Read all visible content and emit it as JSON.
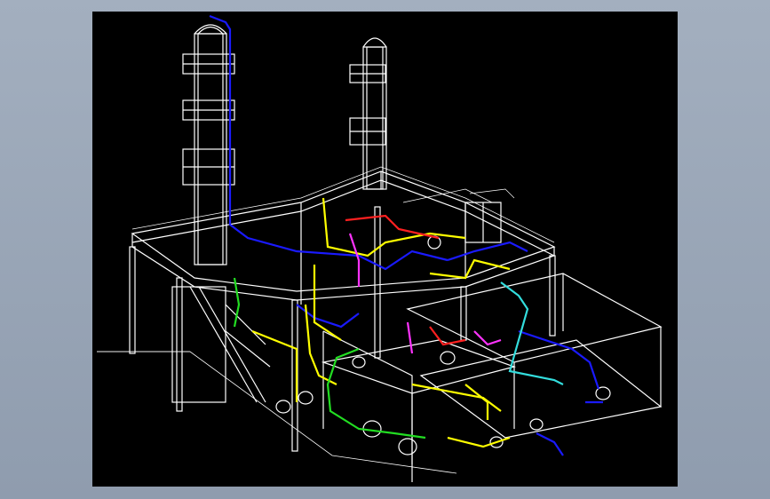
{
  "app": {
    "window_bg_top": "#a3afbf",
    "window_bg_bottom": "#8f9cae"
  },
  "viewport": {
    "background": "#000000",
    "description_icon": "cad-3d-viewport-icon"
  },
  "palette": {
    "structure": "#ffffff",
    "pipe_blue": "#1a1aff",
    "pipe_yellow": "#ffff00",
    "pipe_green": "#22dd22",
    "pipe_red": "#ff2020",
    "pipe_magenta": "#ff33ff",
    "pipe_cyan": "#33dddd"
  }
}
